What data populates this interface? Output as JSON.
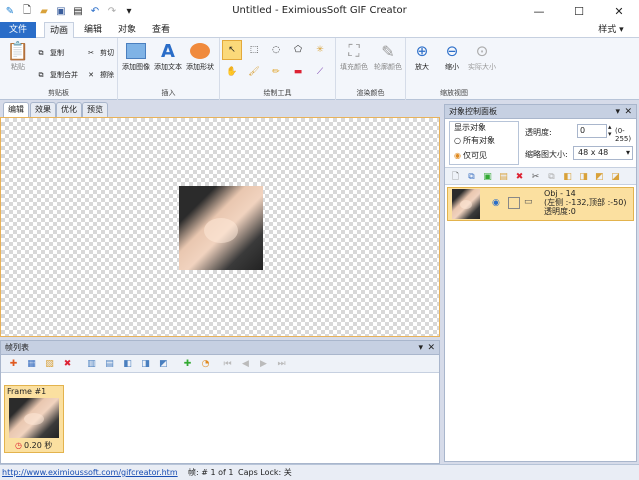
{
  "window": {
    "title": "Untitled - EximiousSoft GIF Creator",
    "help": "样式"
  },
  "ribbon_tabs": [
    {
      "label": "文件"
    },
    {
      "label": "动画"
    },
    {
      "label": "编辑"
    },
    {
      "label": "对象"
    },
    {
      "label": "查看"
    }
  ],
  "groups": {
    "clipboard": {
      "label": "剪贴板",
      "paste": "粘贴",
      "copy": "复制",
      "copy_merge": "复制合并",
      "cut": "剪切",
      "delete": "擦除"
    },
    "insert": {
      "label": "插入",
      "add_image": "添加图像",
      "add_text": "添加文本",
      "add_shape": "添加形状"
    },
    "draw": {
      "label": "绘制工具"
    },
    "fill": {
      "label": "渲染颜色",
      "fill_color": "填充颜色",
      "outline_color": "轮廓颜色"
    },
    "zoom": {
      "label": "缩放视图",
      "zoom_in": "放大",
      "zoom_out": "缩小",
      "actual_size": "实际大小"
    }
  },
  "doc_tabs": [
    {
      "label": "编辑"
    },
    {
      "label": "效果"
    },
    {
      "label": "优化"
    },
    {
      "label": "预览"
    }
  ],
  "frame_panel": {
    "title": "帧列表",
    "frame_label": "Frame #1",
    "delay": "0.20 秒"
  },
  "object_panel": {
    "title": "对象控制面板",
    "show_objects": "显示对象",
    "all_objects": "所有对象",
    "visible_only": "仅可见",
    "transparency_label": "透明度:",
    "transparency_value": "0",
    "transparency_range": "(0-255)",
    "thumb_size_label": "缩略图大小:",
    "thumb_size_value": "48 x 48",
    "object": {
      "name": "Obj - 14",
      "position": "(左侧 :-132,顶部 :-50)",
      "transparency": "透明度:0"
    }
  },
  "status": {
    "url": "http://www.eximioussoft.com/gifcreator.htm",
    "frame": "帧: # 1 of 1",
    "caps": "Caps Lock: 关"
  }
}
